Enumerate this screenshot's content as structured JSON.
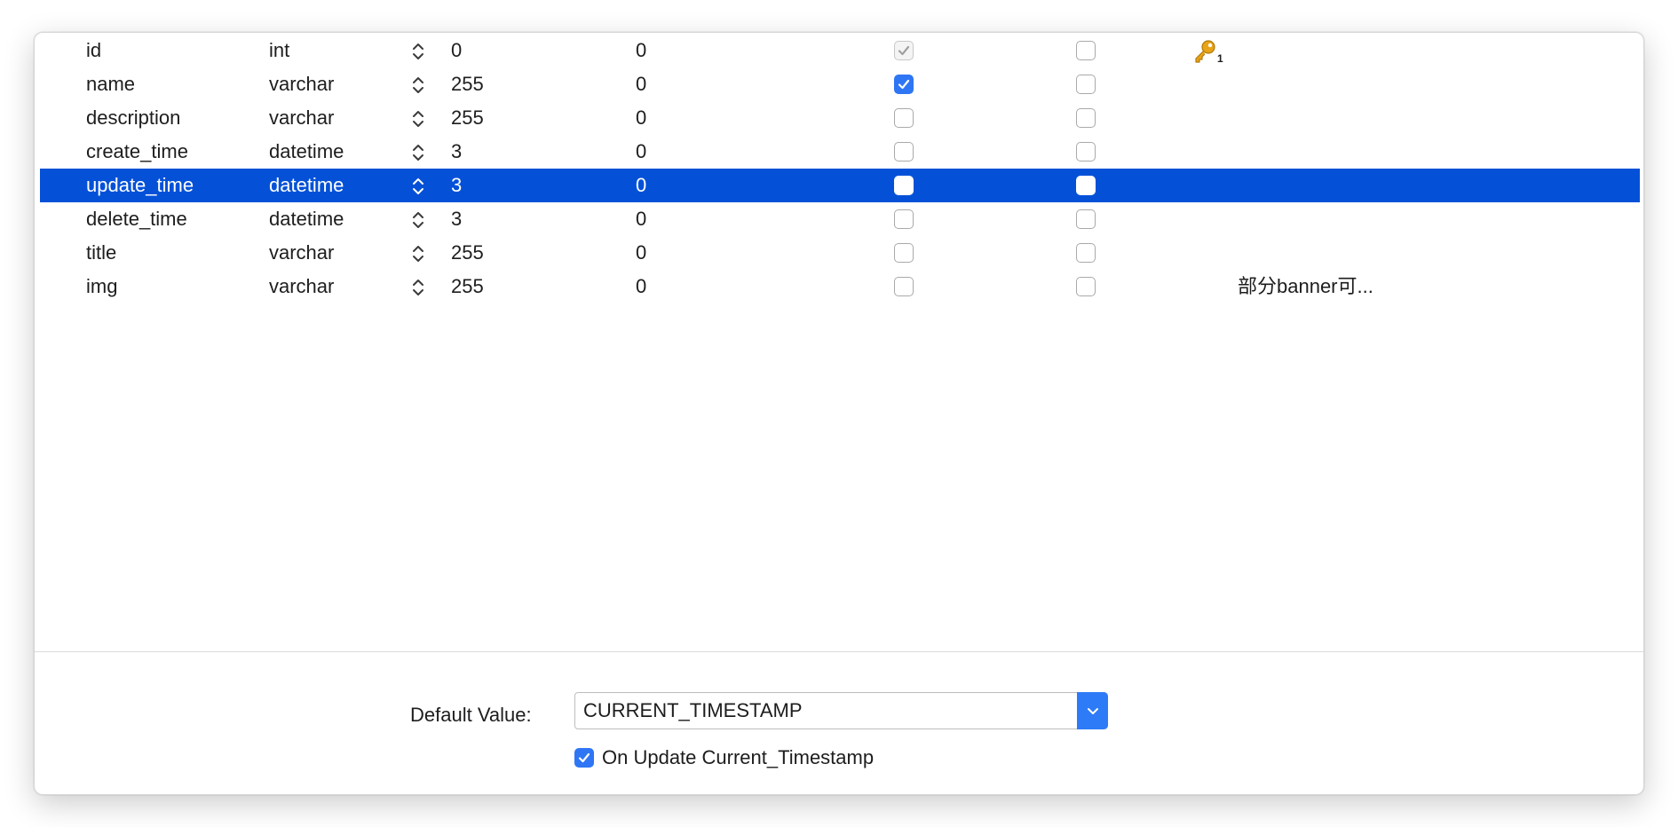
{
  "table": {
    "rows": [
      {
        "name": "id",
        "type": "int",
        "length": "0",
        "decimals": "0",
        "not_null": "checked-disabled",
        "unsigned": false,
        "key_icon": "primary-key-icon",
        "key_index": "1",
        "comment": ""
      },
      {
        "name": "name",
        "type": "varchar",
        "length": "255",
        "decimals": "0",
        "not_null": "checked",
        "unsigned": false,
        "comment": ""
      },
      {
        "name": "description",
        "type": "varchar",
        "length": "255",
        "decimals": "0",
        "not_null": "unchecked",
        "unsigned": false,
        "comment": ""
      },
      {
        "name": "create_time",
        "type": "datetime",
        "length": "3",
        "decimals": "0",
        "not_null": "unchecked",
        "unsigned": false,
        "comment": ""
      },
      {
        "name": "update_time",
        "type": "datetime",
        "length": "3",
        "decimals": "0",
        "not_null": "unchecked",
        "unsigned": false,
        "comment": "",
        "selected": true
      },
      {
        "name": "delete_time",
        "type": "datetime",
        "length": "3",
        "decimals": "0",
        "not_null": "unchecked",
        "unsigned": false,
        "comment": ""
      },
      {
        "name": "title",
        "type": "varchar",
        "length": "255",
        "decimals": "0",
        "not_null": "unchecked",
        "unsigned": false,
        "comment": ""
      },
      {
        "name": "img",
        "type": "varchar",
        "length": "255",
        "decimals": "0",
        "not_null": "unchecked",
        "unsigned": false,
        "comment": "部分banner可..."
      }
    ]
  },
  "default_value": {
    "label": "Default Value:",
    "value": "CURRENT_TIMESTAMP",
    "arrow_icon": "chevron-down-icon"
  },
  "on_update": {
    "label": "On Update Current_Timestamp",
    "checked": true
  },
  "colors": {
    "selection": "#0451d8",
    "checkbox_accent": "#2f76f5",
    "key_icon": "#e8a317"
  }
}
